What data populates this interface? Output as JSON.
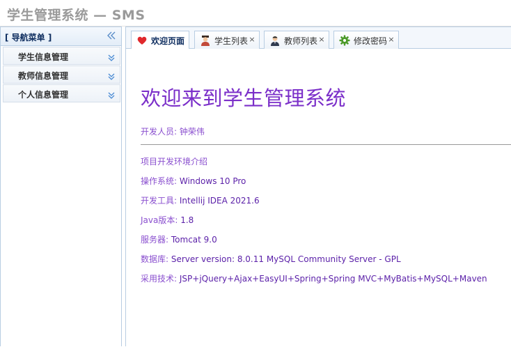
{
  "app": {
    "title": "学生管理系统 — SMS"
  },
  "sidebar": {
    "title": "[ 导航菜单 ]",
    "items": [
      {
        "label": "学生信息管理"
      },
      {
        "label": "教师信息管理"
      },
      {
        "label": "个人信息管理"
      }
    ]
  },
  "tabs": [
    {
      "label": "欢迎页面",
      "icon": "heart-icon",
      "closable": false,
      "active": true
    },
    {
      "label": "学生列表",
      "icon": "student-icon",
      "closable": true,
      "active": false
    },
    {
      "label": "教师列表",
      "icon": "teacher-icon",
      "closable": true,
      "active": false
    },
    {
      "label": "修改密码",
      "icon": "gear-icon",
      "closable": true,
      "active": false
    }
  ],
  "tab_close_glyph": "×",
  "content": {
    "heading": "欢迎来到学生管理系统",
    "developer_label": "开发人员:",
    "developer_value": "钟荣伟",
    "env_heading": "项目开发环境介绍",
    "env": [
      {
        "label": "操作系统:",
        "value": "Windows 10 Pro"
      },
      {
        "label": "开发工具:",
        "value": "Intellij IDEA 2021.6"
      },
      {
        "label": "Java版本:",
        "value": "1.8"
      },
      {
        "label": "服务器:",
        "value": "Tomcat 9.0"
      },
      {
        "label": "数据库:",
        "value": "Server version: 8.0.11 MySQL Community Server - GPL"
      },
      {
        "label": "采用技术:",
        "value": "JSP+jQuery+Ajax+EasyUI+Spring+Spring MVC+MyBatis+MySQL+Maven"
      }
    ]
  },
  "colors": {
    "accent": "#7b2fc9",
    "border": "#b8cde2",
    "title_gray": "#9a9a9a"
  }
}
